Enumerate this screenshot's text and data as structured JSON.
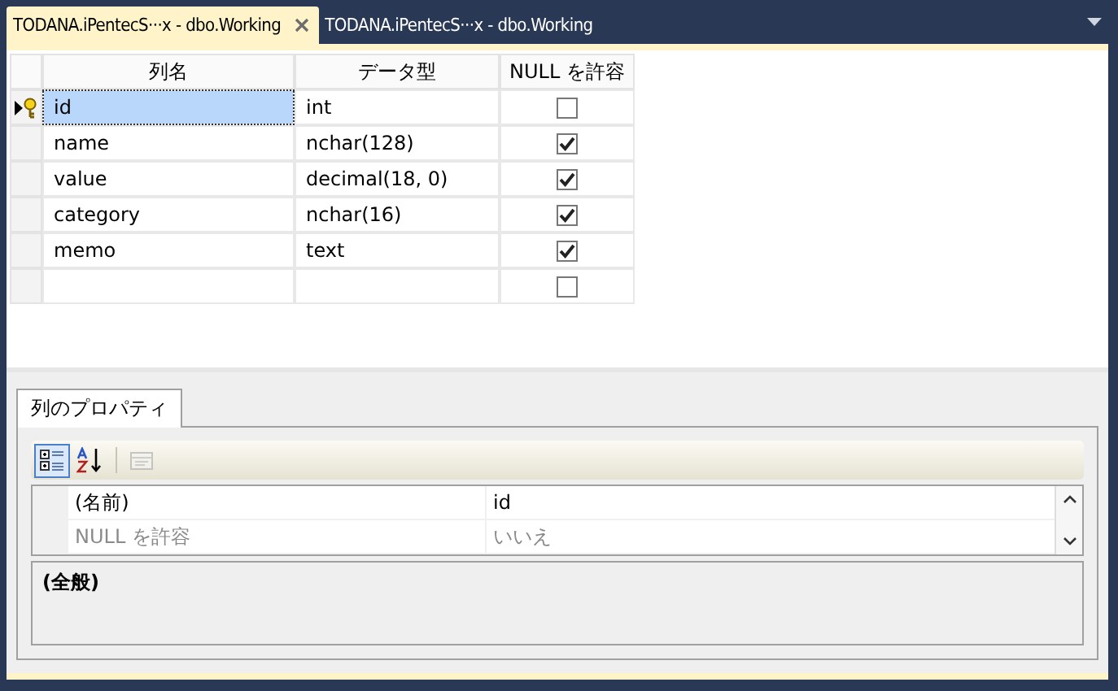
{
  "tabs": [
    {
      "label": "TODANA.iPentecS···x - dbo.Working",
      "selected": true,
      "closable": true
    },
    {
      "label": "TODANA.iPentecS···x - dbo.Working",
      "selected": false,
      "closable": false
    }
  ],
  "grid": {
    "columns": [
      "列名",
      "データ型",
      "NULL を許容"
    ],
    "rows": [
      {
        "name": "id",
        "type": "int",
        "allow_null": false,
        "selected": true,
        "primary_key": true
      },
      {
        "name": "name",
        "type": "nchar(128)",
        "allow_null": true,
        "selected": false,
        "primary_key": false
      },
      {
        "name": "value",
        "type": "decimal(18, 0)",
        "allow_null": true,
        "selected": false,
        "primary_key": false
      },
      {
        "name": "category",
        "type": "nchar(16)",
        "allow_null": true,
        "selected": false,
        "primary_key": false
      },
      {
        "name": "memo",
        "type": "text",
        "allow_null": true,
        "selected": false,
        "primary_key": false
      },
      {
        "name": "",
        "type": "",
        "allow_null": false,
        "selected": false,
        "primary_key": false
      }
    ]
  },
  "properties": {
    "tab": {
      "label": "列のプロパティ",
      "selected": true
    },
    "toolbar": [
      {
        "kind": "categorized",
        "selected": true,
        "disabled": false
      },
      {
        "kind": "alphabetical",
        "selected": false,
        "disabled": false
      },
      {
        "kind": "pages",
        "selected": false,
        "disabled": true
      }
    ],
    "rows": [
      {
        "name": "(名前)",
        "value": "id",
        "disabled": false
      },
      {
        "name": "NULL を許容",
        "value": "いいえ",
        "disabled": true
      }
    ],
    "description": "(全般)"
  }
}
